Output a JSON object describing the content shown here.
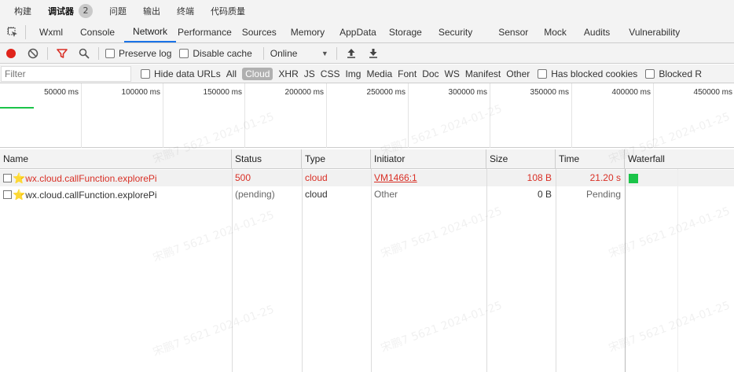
{
  "top_tabs": [
    {
      "label": "构建"
    },
    {
      "label": "调试器",
      "badge": "2"
    },
    {
      "label": "问题"
    },
    {
      "label": "输出"
    },
    {
      "label": "终端"
    },
    {
      "label": "代码质量"
    }
  ],
  "panel_tabs": [
    "Wxml",
    "Console",
    "Network",
    "Performance",
    "Sources",
    "Memory",
    "AppData",
    "Storage",
    "Security",
    "Sensor",
    "Mock",
    "Audits",
    "Vulnerability"
  ],
  "toolbar": {
    "preserve_log": "Preserve log",
    "disable_cache": "Disable cache",
    "throttle": "Online"
  },
  "filterbar": {
    "placeholder": "Filter",
    "hide_data_urls": "Hide data URLs",
    "types": [
      "All",
      "Cloud",
      "XHR",
      "JS",
      "CSS",
      "Img",
      "Media",
      "Font",
      "Doc",
      "WS",
      "Manifest",
      "Other"
    ],
    "has_blocked_cookies": "Has blocked cookies",
    "blocked_requests": "Blocked R"
  },
  "overview_ticks": [
    "50000 ms",
    "100000 ms",
    "150000 ms",
    "200000 ms",
    "250000 ms",
    "300000 ms",
    "350000 ms",
    "400000 ms",
    "450000 ms"
  ],
  "table": {
    "headers": [
      "Name",
      "Status",
      "Type",
      "Initiator",
      "Size",
      "Time",
      "Waterfall"
    ],
    "rows": [
      {
        "name": "wx.cloud.callFunction.explorePi",
        "status": "500",
        "type": "cloud",
        "initiator": "VM1466:1",
        "size": "108 B",
        "time": "21.20 s",
        "error": true
      },
      {
        "name": "wx.cloud.callFunction.explorePi",
        "status": "(pending)",
        "type": "cloud",
        "initiator": "Other",
        "size": "0 B",
        "time": "Pending",
        "error": false
      }
    ]
  },
  "watermark": "宋鹏7 5621 2024-01-25",
  "colors": {
    "accent": "#1a73e8",
    "error": "#d93026",
    "record": "#e0241b",
    "waterfall": "#1bc449"
  }
}
